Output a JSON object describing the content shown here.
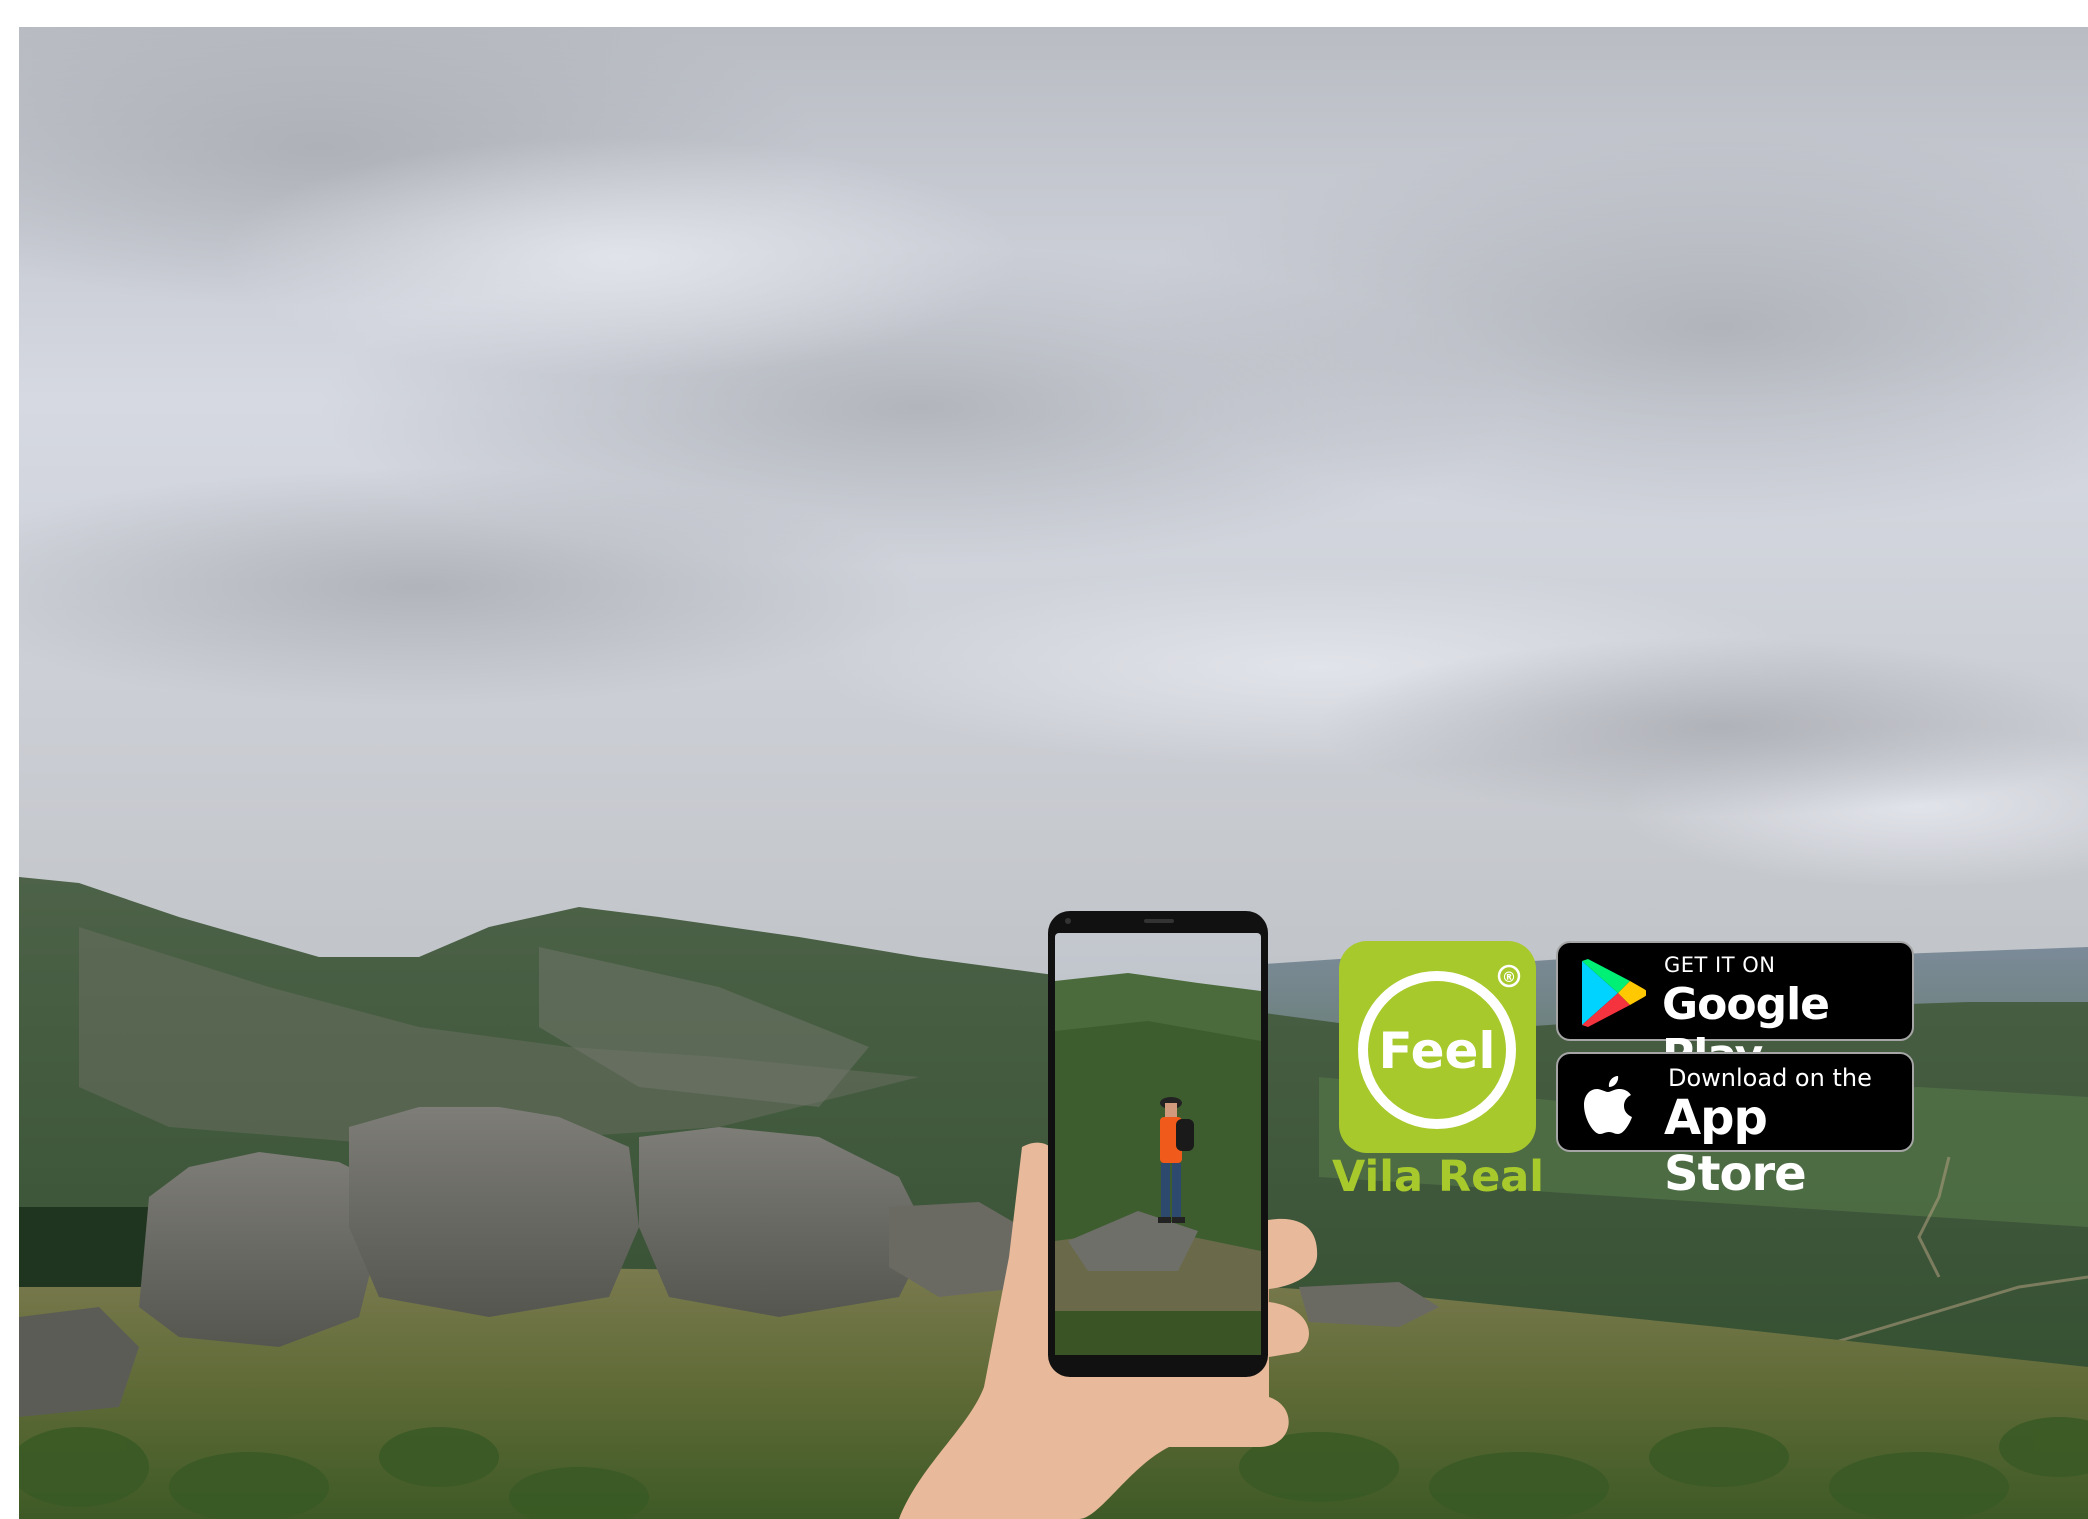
{
  "promo": {
    "app_icon": {
      "icon": "feel-logo-icon",
      "text": "Feel",
      "registered_mark": "®"
    },
    "app_name": "Vila Real",
    "google_play": {
      "small": "GET IT ON",
      "big": "Google Play",
      "icon": "google-play-icon"
    },
    "app_store": {
      "small": "Download on the",
      "big": "App Store",
      "icon": "apple-icon"
    }
  },
  "colors": {
    "brand_green": "#a8c92b",
    "badge_background": "#000000",
    "sky": "#c9ccd3",
    "hills": "#3f5a3a"
  }
}
